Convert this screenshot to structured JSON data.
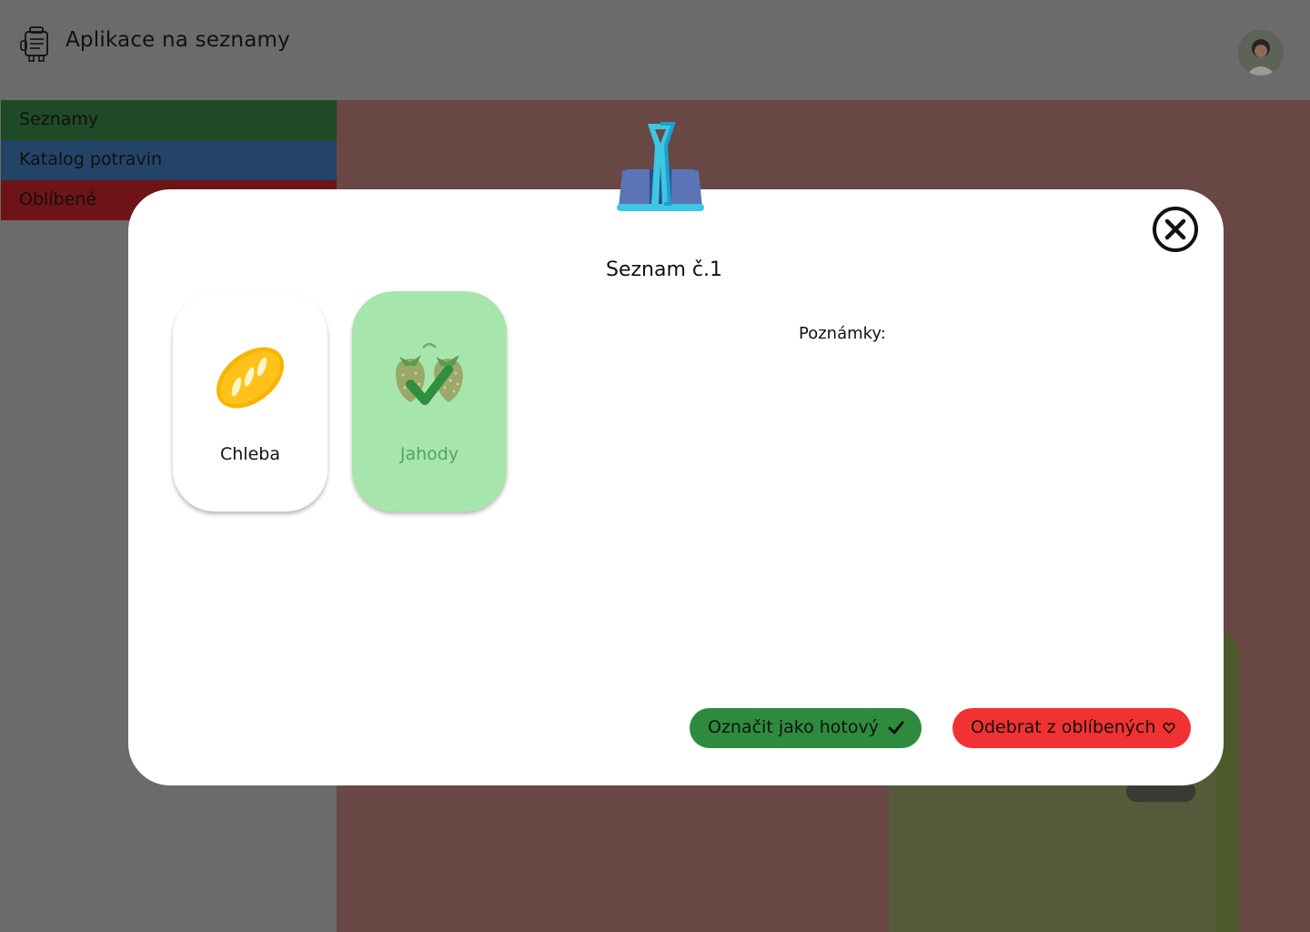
{
  "header": {
    "title": "Aplikace na seznamy",
    "logo_icon": "robot-list-icon",
    "avatar_icon": "user-avatar"
  },
  "sidebar": {
    "items": [
      {
        "label": "Seznamy",
        "color": "#1f4a26"
      },
      {
        "label": "Katalog potravin",
        "color": "#234466"
      },
      {
        "label": "Oblíbené",
        "color": "#6e1416"
      }
    ]
  },
  "modal": {
    "title": "Seznam č.1",
    "header_icon": "binder-clip-icon",
    "close_icon": "close-circle-icon",
    "items": [
      {
        "label": "Chleba",
        "icon": "bread-icon",
        "done": false
      },
      {
        "label": "Jahody",
        "icon": "strawberry-icon",
        "done": true,
        "done_color": "#a6e6ad"
      }
    ],
    "notes_label": "Poznámky:",
    "buttons": {
      "done_label": "Označit jako hotový",
      "done_icon": "checkmark-icon",
      "done_color": "#2e8b3d",
      "unfav_label": "Odebrat z oblíbených",
      "unfav_icon": "heart-icon",
      "unfav_color": "#f23232"
    }
  }
}
